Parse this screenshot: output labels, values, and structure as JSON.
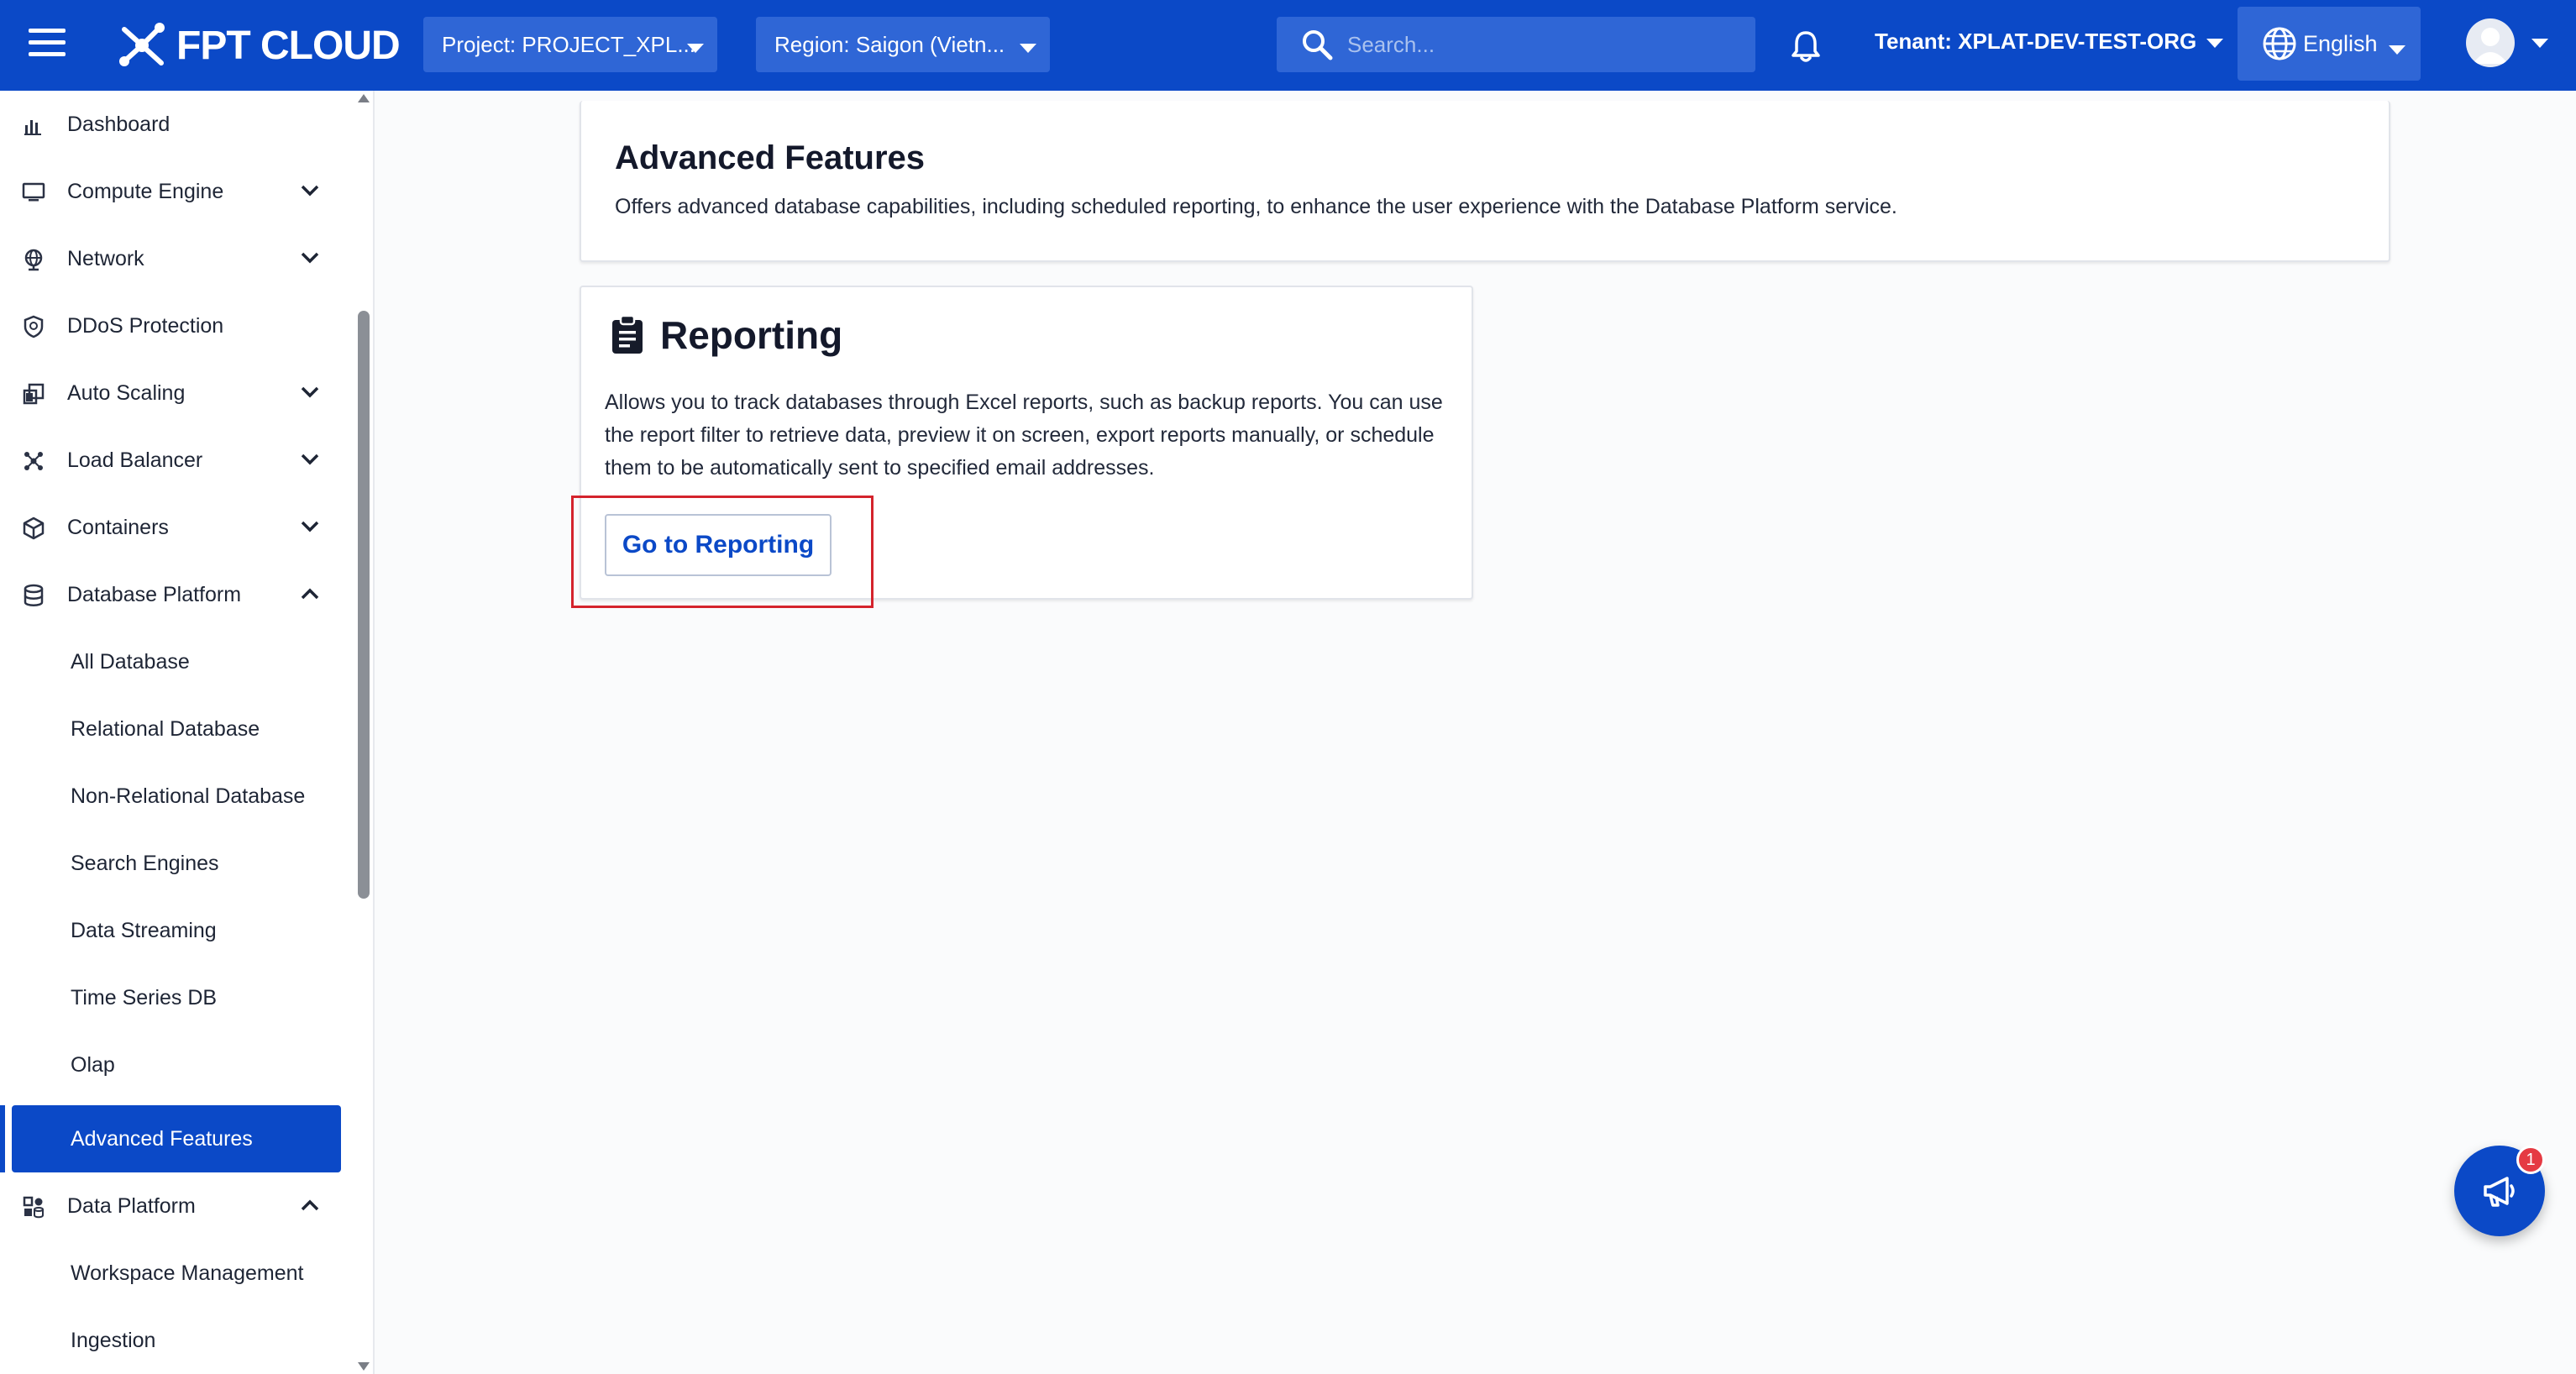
{
  "topbar": {
    "logo_text": "FPT CLOUD",
    "project_label": "Project: PROJECT_XPL...",
    "region_label": "Region: Saigon (Vietn...",
    "search_placeholder": "Search...",
    "tenant_label": "Tenant: XPLAT-DEV-TEST-ORG",
    "language_label": "English"
  },
  "sidebar": {
    "items": [
      {
        "label": "Dashboard",
        "icon": "bar-chart-icon"
      },
      {
        "label": "Compute Engine",
        "icon": "monitor-icon"
      },
      {
        "label": "Network",
        "icon": "globe-network-icon"
      },
      {
        "label": "DDoS Protection",
        "icon": "shield-icon"
      },
      {
        "label": "Auto Scaling",
        "icon": "scaling-icon"
      },
      {
        "label": "Load Balancer",
        "icon": "cluster-icon"
      },
      {
        "label": "Containers",
        "icon": "cube-icon"
      },
      {
        "label": "Database Platform",
        "icon": "database-icon"
      },
      {
        "label": "Data Platform",
        "icon": "data-platform-icon"
      }
    ],
    "database_sub": [
      "All Database",
      "Relational Database",
      "Non-Relational Database",
      "Search Engines",
      "Data Streaming",
      "Time Series DB",
      "Olap",
      "Advanced Features"
    ],
    "data_platform_sub": [
      "Workspace Management",
      "Ingestion"
    ]
  },
  "main": {
    "title": "Advanced Features",
    "description": "Offers advanced database capabilities, including scheduled reporting, to enhance the user experience with the Database Platform service.",
    "reporting": {
      "title": "Reporting",
      "description": "Allows you to track databases through Excel reports, such as backup reports. You can use the report filter to retrieve data, preview it on screen, export reports manually, or schedule them to be automatically sent to specified email addresses.",
      "button_label": "Go to Reporting"
    }
  },
  "fab": {
    "badge": "1",
    "icon": "megaphone-icon"
  },
  "colors": {
    "primary": "#0b49c7",
    "highlight": "#d4232c",
    "badge": "#e53a43"
  }
}
